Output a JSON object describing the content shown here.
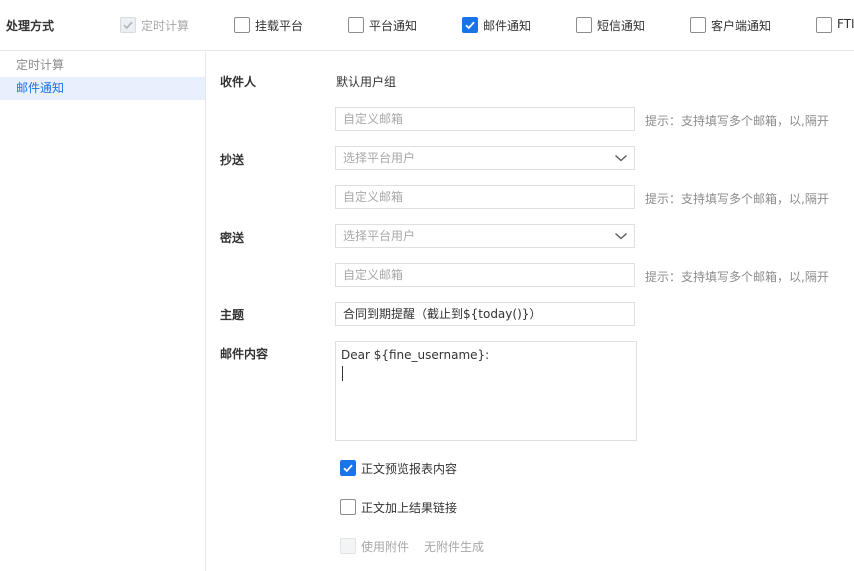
{
  "header": {
    "label": "处理方式",
    "options": [
      {
        "label": "定时计算",
        "state": "disabled-checked"
      },
      {
        "label": "挂载平台",
        "state": "unchecked"
      },
      {
        "label": "平台通知",
        "state": "unchecked"
      },
      {
        "label": "邮件通知",
        "state": "checked"
      },
      {
        "label": "短信通知",
        "state": "unchecked"
      },
      {
        "label": "客户端通知",
        "state": "unchecked"
      },
      {
        "label": "FTI",
        "state": "unchecked"
      }
    ]
  },
  "sidebar": {
    "items": [
      {
        "label": "定时计算",
        "state": "muted"
      },
      {
        "label": "邮件通知",
        "state": "active"
      }
    ]
  },
  "form": {
    "recipient": {
      "label": "收件人",
      "value": "默认用户组",
      "custom_placeholder": "自定义邮箱",
      "hint": "提示：支持填写多个邮箱，以,隔开"
    },
    "cc": {
      "label": "抄送",
      "select_placeholder": "选择平台用户",
      "custom_placeholder": "自定义邮箱",
      "hint": "提示：支持填写多个邮箱，以,隔开"
    },
    "bcc": {
      "label": "密送",
      "select_placeholder": "选择平台用户",
      "custom_placeholder": "自定义邮箱",
      "hint": "提示：支持填写多个邮箱，以,隔开"
    },
    "subject": {
      "label": "主题",
      "value": "合同到期提醒（截止到${today()}）"
    },
    "content": {
      "label": "邮件内容",
      "value": "Dear ${fine_username}:"
    },
    "options": [
      {
        "label": "正文预览报表内容",
        "state": "checked"
      },
      {
        "label": "正文加上结果链接",
        "state": "unchecked"
      },
      {
        "label": "使用附件",
        "state": "disabled",
        "note": "无附件生成"
      }
    ]
  },
  "colors": {
    "accent": "#1a73e8",
    "border": "#dcdfe4",
    "muted": "#a8a8a8"
  }
}
